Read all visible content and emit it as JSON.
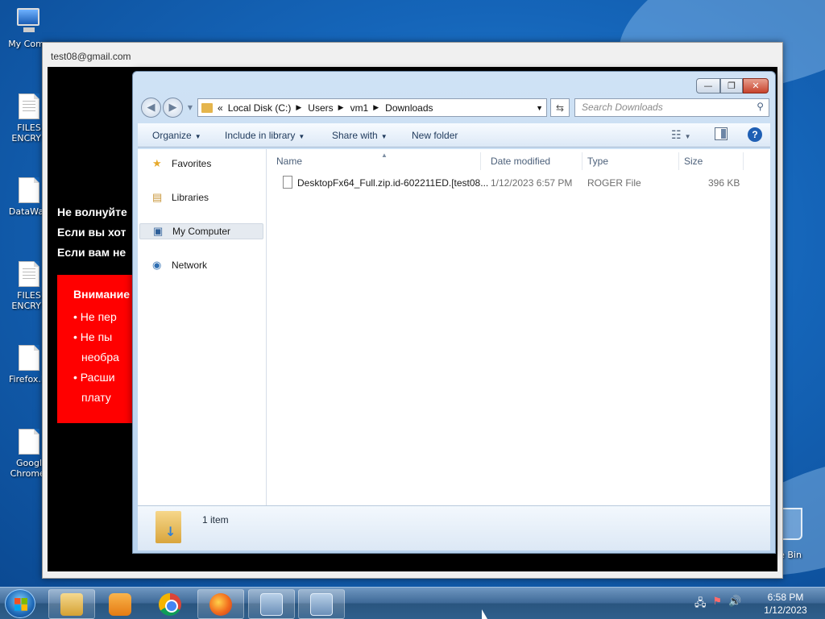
{
  "desktop": {
    "icons": [
      {
        "label": "My Comp"
      },
      {
        "label": "FILES\nENCRYP"
      },
      {
        "label": "DataWag"
      },
      {
        "label": "FILES\nENCRYP"
      },
      {
        "label": "Firefox.In"
      },
      {
        "label": "Googl\nChrome."
      }
    ],
    "recycle_label": "cle Bin"
  },
  "ransom_window": {
    "title": "test08@gmail.com",
    "lines": [
      "Не волнуйте",
      "Если вы хот",
      "Если вам не"
    ],
    "notice": {
      "heading": "Внимание",
      "bullets": [
        "Не пер",
        "Не пы",
        "необра",
        "Расши",
        "плату"
      ]
    }
  },
  "explorer": {
    "window_buttons": {
      "minimize": "—",
      "maximize": "❐",
      "close": "✕"
    },
    "address": {
      "overflow": "«",
      "crumbs": [
        "Local Disk (C:)",
        "Users",
        "vm1",
        "Downloads"
      ]
    },
    "search_placeholder": "Search Downloads",
    "toolbar": {
      "organize": "Organize",
      "include_in_library": "Include in library",
      "share_with": "Share with",
      "new_folder": "New folder"
    },
    "nav": {
      "favorites": "Favorites",
      "libraries": "Libraries",
      "my_computer": "My Computer",
      "network": "Network"
    },
    "columns": {
      "name": "Name",
      "date_modified": "Date modified",
      "type": "Type",
      "size": "Size"
    },
    "files": [
      {
        "name": "DesktopFx64_Full.zip.id-602211ED.[test08...",
        "date_modified": "1/12/2023 6:57 PM",
        "type": "ROGER File",
        "size": "396 KB"
      }
    ],
    "status": "1 item"
  },
  "taskbar": {
    "clock_time": "6:58 PM",
    "clock_date": "1/12/2023",
    "tray_icons": [
      "network-icon",
      "action-center-flag-icon",
      "volume-icon"
    ]
  },
  "colors": {
    "desktop_blue": "#1565b9",
    "ransom_red": "#ff0000",
    "ransom_bg": "#000000",
    "search_placeholder": "#8a8a8a"
  }
}
